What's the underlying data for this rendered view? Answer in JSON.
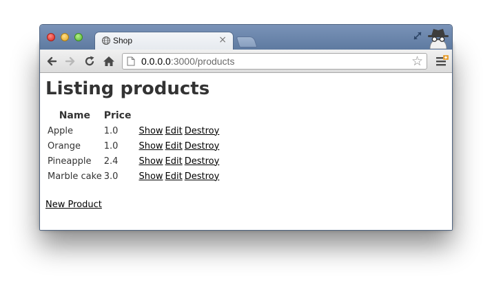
{
  "browser": {
    "tab_title": "Shop",
    "tab_close": "×",
    "url_host": "0.0.0.0",
    "url_rest": ":3000/products",
    "star_glyph": "☆"
  },
  "page": {
    "title": "Listing products",
    "columns": [
      "Name",
      "Price"
    ],
    "rows": [
      {
        "name": "Apple",
        "price": "1.0"
      },
      {
        "name": "Orange",
        "price": "1.0"
      },
      {
        "name": "Pineapple",
        "price": "2.4"
      },
      {
        "name": "Marble cake",
        "price": "3.0"
      }
    ],
    "actions": {
      "show": "Show",
      "edit": "Edit",
      "destroy": "Destroy"
    },
    "new_link": "New Product"
  },
  "colors": {
    "titlebar": "#6a86ad",
    "text": "#333333",
    "link": "#000000"
  },
  "icons": {
    "tab": "globe-icon",
    "back": "back-arrow-icon",
    "forward": "forward-arrow-icon",
    "reload": "reload-icon",
    "home": "home-icon",
    "bookmark": "star-icon",
    "menu": "wrench-menu-icon",
    "incognito": "incognito-icon",
    "fullscreen": "fullscreen-icon"
  }
}
